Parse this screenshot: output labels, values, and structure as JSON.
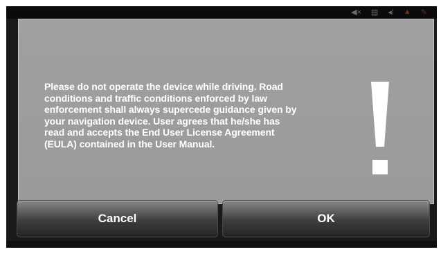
{
  "status_bar": {
    "icons": [
      "mute-icon",
      "battery-icon",
      "signal-icon",
      "alert-icon",
      "gps-icon"
    ]
  },
  "dialog": {
    "message_lines": [
      "Please do not operate the device while driving. Road",
      "conditions and traffic conditions enforced by law",
      "enforcement shall always supercede guidance given by",
      "your navigation device. User agrees that he/she has",
      "read and accepts the End User License Agreement",
      "(EULA) contained in the User Manual."
    ],
    "icon": "exclamation-icon"
  },
  "buttons": {
    "cancel_label": "Cancel",
    "ok_label": "OK"
  },
  "colors": {
    "dialog_background": "#9e9e9e",
    "text": "#ffffff",
    "button_top": "#8a8a8a",
    "button_bottom": "#242424"
  }
}
